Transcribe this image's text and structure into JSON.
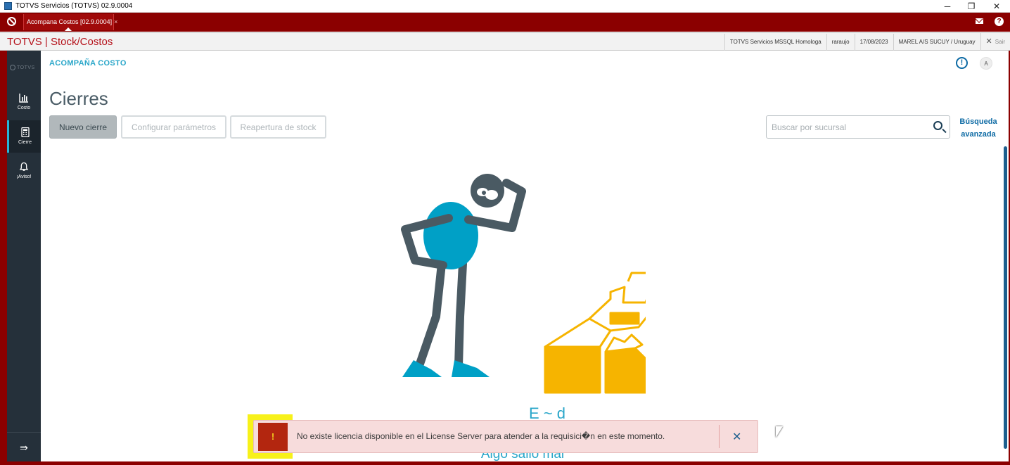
{
  "window": {
    "title": "TOTVS Servicios (TOTVS) 02.9.0004",
    "minimize_glyph": "─",
    "restore_glyph": "❐",
    "close_glyph": "✕"
  },
  "tabbar": {
    "tab_label": "Acompana Costos [02.9.0004]",
    "tab_close": "×",
    "help_glyph": "?"
  },
  "appbar": {
    "brand": "TOTVS | Stock/Costos",
    "environment": "TOTVS Servicios MSSQL Homologa",
    "user": "raraujo",
    "date": "17/08/2023",
    "company": "MAREL A/S SUCUY / Uruguay",
    "exit_label": "Sair",
    "exit_glyph": "✕"
  },
  "sidebar": {
    "logo": "TOTVS",
    "items": [
      {
        "label": "Costo",
        "icon": "bar-chart-icon"
      },
      {
        "label": "Cierre",
        "icon": "calculator-icon"
      },
      {
        "label": "¡Aviso!",
        "icon": "bell-icon"
      }
    ],
    "collapse_glyph": "⇛"
  },
  "main": {
    "breadcrumb": "ACOMPAÑA COSTO",
    "info_glyph": "!",
    "avatar_letter": "A",
    "title": "Cierres",
    "buttons": {
      "new": "Nuevo cierre",
      "config": "Configurar parámetros",
      "reopen": "Reapertura de stock"
    },
    "search": {
      "placeholder": "Buscar por sucursal"
    },
    "advanced_search": "Búsqueda avanzada",
    "empty_title": "E   ~   d",
    "empty_subtitle": "Algo salió mal"
  },
  "toast": {
    "icon_glyph": "!",
    "message": "No existe licencia disponible en el License Server para atender a la requisici�n en este momento.",
    "close_glyph": "✕"
  },
  "colors": {
    "frame": "#8b0000",
    "brand_text": "#b5121b",
    "sidebar_bg": "#25303a",
    "accent": "#29a6c9",
    "link": "#0c6aa4",
    "toast_bg": "#f7dcdc",
    "toast_icon_bg": "#b3260f",
    "highlight": "#f7f11a",
    "illustration_figure": "#4a5a63",
    "illustration_body": "#00a0c6",
    "illustration_blocks": "#f6b400"
  }
}
